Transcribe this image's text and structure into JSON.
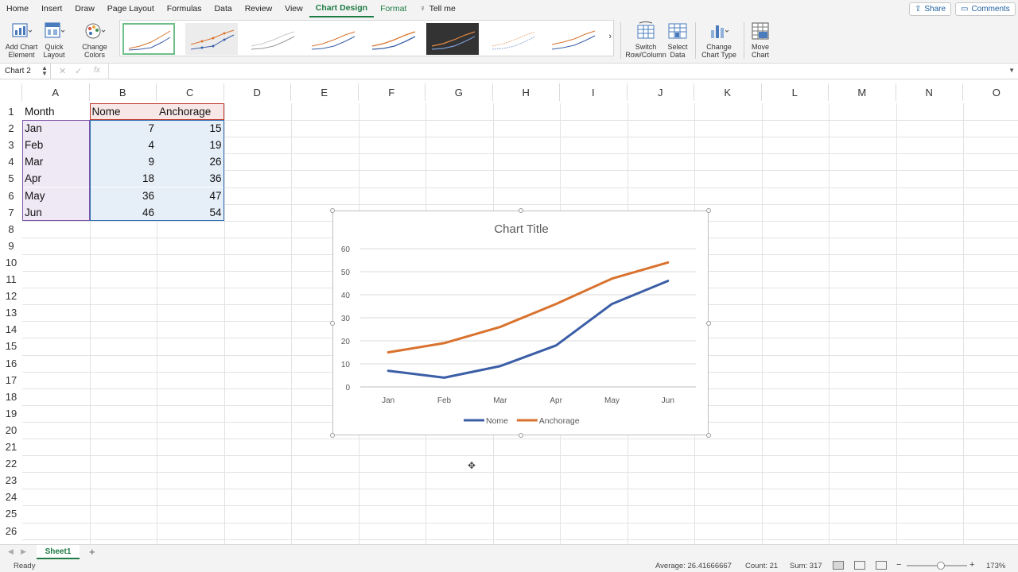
{
  "menu": {
    "tabs": [
      "Home",
      "Insert",
      "Draw",
      "Page Layout",
      "Formulas",
      "Data",
      "Review",
      "View",
      "Chart Design",
      "Format"
    ],
    "active_tab": "Chart Design",
    "tell_me": "Tell me",
    "share": "Share",
    "comments": "Comments"
  },
  "ribbon": {
    "add_chart_element": [
      "Add Chart",
      "Element"
    ],
    "quick_layout": [
      "Quick",
      "Layout"
    ],
    "change_colors": [
      "Change",
      "Colors"
    ],
    "switch_row_column": [
      "Switch",
      "Row/Column"
    ],
    "select_data": [
      "Select",
      "Data"
    ],
    "change_chart_type": [
      "Change",
      "Chart Type"
    ],
    "move_chart": [
      "Move",
      "Chart"
    ],
    "gallery_next": "›"
  },
  "formula_bar": {
    "name_box": "Chart 2",
    "cancel_icon": "✕",
    "enter_icon": "✓",
    "fx": "fx",
    "value": ""
  },
  "grid": {
    "columns": [
      "A",
      "B",
      "C",
      "D",
      "E",
      "F",
      "G",
      "H",
      "I",
      "J",
      "K",
      "L",
      "M",
      "N",
      "O"
    ],
    "rows": [
      "1",
      "2",
      "3",
      "4",
      "5",
      "6",
      "7",
      "8",
      "9",
      "10",
      "11",
      "12",
      "13",
      "14",
      "15",
      "16",
      "17",
      "18",
      "19",
      "20",
      "21",
      "22",
      "23",
      "24",
      "25",
      "26"
    ],
    "header": [
      "Month",
      "Nome",
      "Anchorage"
    ],
    "data": [
      [
        "Jan",
        "7",
        "15"
      ],
      [
        "Feb",
        "4",
        "19"
      ],
      [
        "Mar",
        "9",
        "26"
      ],
      [
        "Apr",
        "18",
        "36"
      ],
      [
        "May",
        "36",
        "47"
      ],
      [
        "Jun",
        "46",
        "54"
      ]
    ]
  },
  "chart_data": {
    "type": "line",
    "title": "Chart Title",
    "categories": [
      "Jan",
      "Feb",
      "Mar",
      "Apr",
      "May",
      "Jun"
    ],
    "series": [
      {
        "name": "Nome",
        "values": [
          7,
          4,
          9,
          18,
          36,
          46
        ],
        "color": "#3b5ea6"
      },
      {
        "name": "Anchorage",
        "values": [
          15,
          19,
          26,
          36,
          47,
          54
        ],
        "color": "#d9722e"
      }
    ],
    "ylim": [
      0,
      60
    ],
    "yticks": [
      0,
      10,
      20,
      30,
      40,
      50,
      60
    ],
    "grid": true,
    "legend": "bottom",
    "xlabel": "",
    "ylabel": ""
  },
  "sheets": {
    "tabs": [
      "Sheet1"
    ],
    "add": "+"
  },
  "status": {
    "ready": "Ready",
    "average": "Average: 26.41666667",
    "count": "Count: 21",
    "sum": "Sum: 317",
    "zoom_minus": "−",
    "zoom_plus": "+",
    "zoom": "173%"
  },
  "colors": {
    "accent": "#1e7b45",
    "nome": "#3b5ea6",
    "anchorage": "#d9722e",
    "range_month": "#7b55a8",
    "range_series_names": "#c0392b",
    "range_values": "#2f6db5"
  }
}
